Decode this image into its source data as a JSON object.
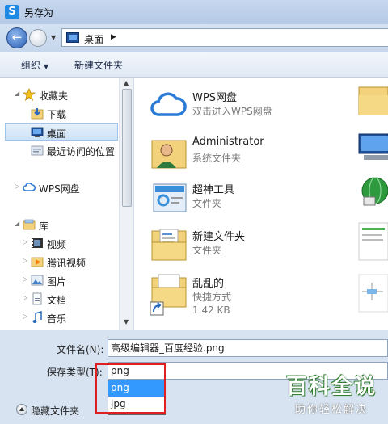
{
  "window": {
    "title": "另存为",
    "app_icon": "S"
  },
  "address": {
    "location": "桌面"
  },
  "toolbar": {
    "organize": "组织",
    "new_folder": "新建文件夹"
  },
  "sidebar": {
    "favorites": "收藏夹",
    "downloads": "下载",
    "desktop": "桌面",
    "recent": "最近访问的位置",
    "wps_drive": "WPS网盘",
    "libraries": "库",
    "videos": "视频",
    "tencent_video": "腾讯视频",
    "pictures": "图片",
    "documents": "文档",
    "music": "音乐"
  },
  "files": [
    {
      "name": "WPS网盘",
      "sub": "双击进入WPS网盘",
      "icon": "cloud-icon"
    },
    {
      "name": "Administrator",
      "sub": "系统文件夹",
      "icon": "user-folder-icon"
    },
    {
      "name": "超神工具",
      "sub": "文件夹",
      "icon": "tool-folder-icon"
    },
    {
      "name": "新建文件夹",
      "sub": "文件夹",
      "icon": "folder-icon"
    },
    {
      "name": "乱乱的",
      "sub": "快捷方式",
      "size": "1.42 KB",
      "icon": "shortcut-folder-icon"
    }
  ],
  "form": {
    "filename_label": "文件名(N):",
    "filename_value": "高级编辑器_百度经验.png",
    "filetype_label": "保存类型(T):",
    "filetype_value": "png",
    "options": [
      "png",
      "jpg"
    ],
    "hide_folders": "隐藏文件夹"
  },
  "watermark": {
    "main": "百科全说",
    "sub": "助你轻松解决"
  },
  "colors": {
    "selection": "#3399ff",
    "highlight_box": "#e02020",
    "accent": "#1e88e5"
  }
}
